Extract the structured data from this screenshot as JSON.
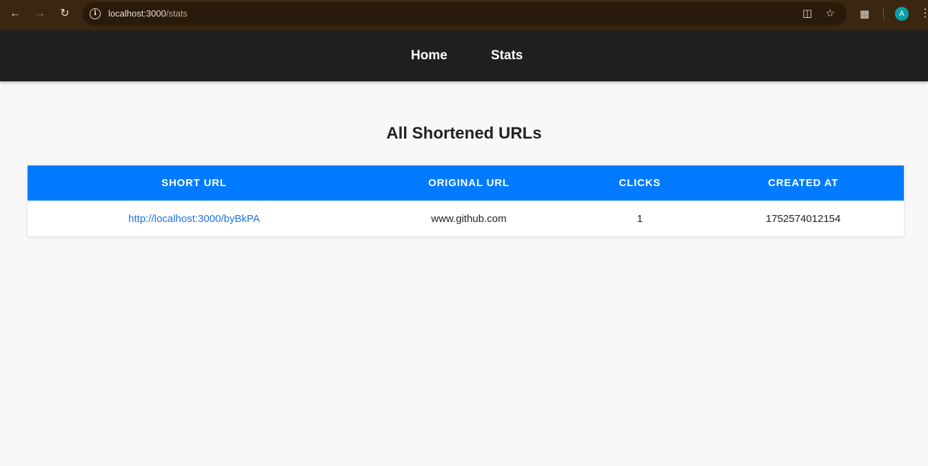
{
  "browser": {
    "url_host": "localhost:3000",
    "url_path": "/stats",
    "avatar_letter": "A"
  },
  "nav": {
    "home_label": "Home",
    "stats_label": "Stats"
  },
  "main": {
    "title": "All Shortened URLs",
    "table": {
      "headers": [
        "Short URL",
        "Original URL",
        "Clicks",
        "Created At"
      ],
      "rows": [
        {
          "short_url": "http://localhost:3000/byBkPA",
          "original_url": "www.github.com",
          "clicks": "1",
          "created_at": "1752574012154"
        }
      ]
    }
  },
  "colors": {
    "header_bg": "#007bff",
    "nav_bg": "#1f1f1f",
    "link": "#1a73e8"
  }
}
